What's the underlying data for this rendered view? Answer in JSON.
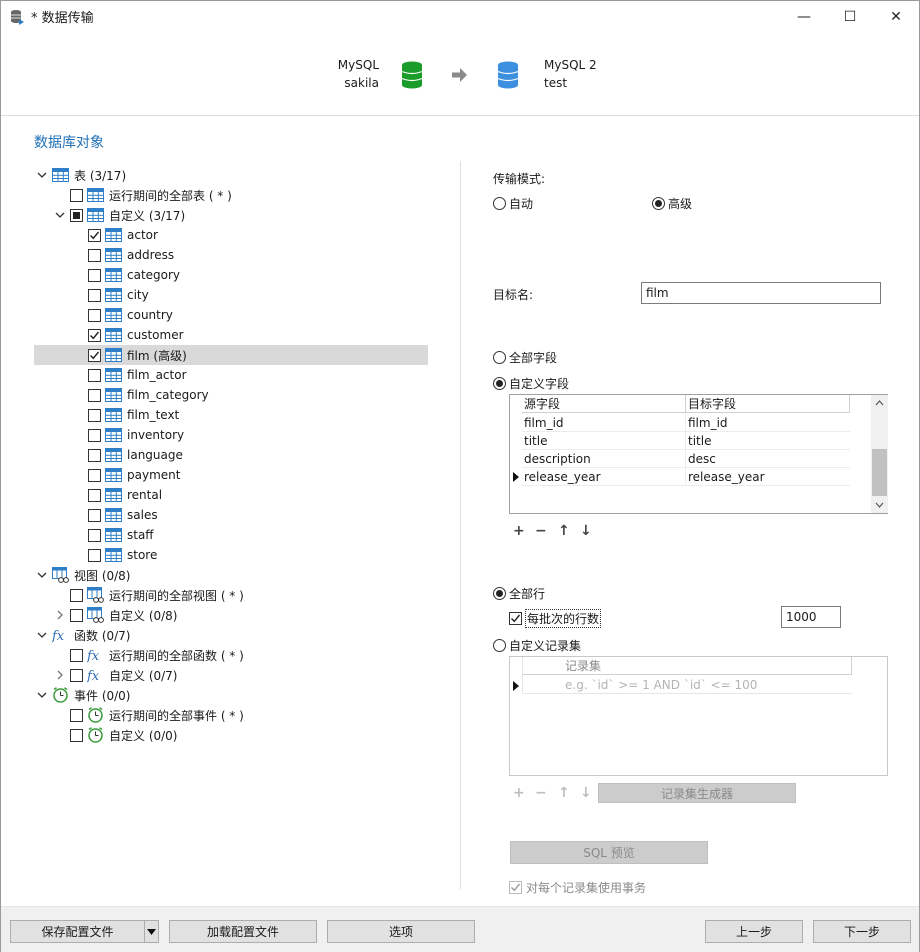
{
  "window": {
    "title": "* 数据传输",
    "controls": {
      "minimize": "—",
      "maximize": "☐",
      "close": "✕"
    }
  },
  "header": {
    "source": {
      "type": "MySQL",
      "name": "sakila"
    },
    "target": {
      "type": "MySQL 2",
      "name": "test"
    },
    "colors": {
      "source_db": "#1a9c2b",
      "target_db": "#3d8fe0",
      "arrow": "#8a8a8a"
    }
  },
  "objects": {
    "title": "数据库对象",
    "tables": {
      "label": "表 (3/17)",
      "all_runtime": "运行期间的全部表 ( * )",
      "custom": "自定义 (3/17)",
      "items": [
        {
          "name": "actor",
          "checked": true
        },
        {
          "name": "address",
          "checked": false
        },
        {
          "name": "category",
          "checked": false
        },
        {
          "name": "city",
          "checked": false
        },
        {
          "name": "country",
          "checked": false
        },
        {
          "name": "customer",
          "checked": true
        },
        {
          "name": "film (高级)",
          "checked": true,
          "selected": true
        },
        {
          "name": "film_actor",
          "checked": false
        },
        {
          "name": "film_category",
          "checked": false
        },
        {
          "name": "film_text",
          "checked": false
        },
        {
          "name": "inventory",
          "checked": false
        },
        {
          "name": "language",
          "checked": false
        },
        {
          "name": "payment",
          "checked": false
        },
        {
          "name": "rental",
          "checked": false
        },
        {
          "name": "sales",
          "checked": false
        },
        {
          "name": "staff",
          "checked": false
        },
        {
          "name": "store",
          "checked": false
        }
      ]
    },
    "views": {
      "label": "视图 (0/8)",
      "all_runtime": "运行期间的全部视图 ( * )",
      "custom": "自定义 (0/8)"
    },
    "functions": {
      "label": "函数 (0/7)",
      "all_runtime": "运行期间的全部函数 ( * )",
      "custom": "自定义 (0/7)"
    },
    "events": {
      "label": "事件 (0/0)",
      "all_runtime": "运行期间的全部事件 ( * )",
      "custom": "自定义 (0/0)"
    }
  },
  "settings": {
    "transfer_mode_label": "传输模式:",
    "mode_auto": "自动",
    "mode_advanced": "高级",
    "target_name_label": "目标名:",
    "target_name_value": "film",
    "all_fields": "全部字段",
    "custom_fields": "自定义字段",
    "fields_header": {
      "source": "源字段",
      "target": "目标字段"
    },
    "fields": [
      {
        "source": "film_id",
        "target": "film_id"
      },
      {
        "source": "title",
        "target": "title"
      },
      {
        "source": "description",
        "target": "desc"
      },
      {
        "source": "release_year",
        "target": "release_year"
      }
    ],
    "all_rows": "全部行",
    "rows_per_batch_label": "每批次的行数",
    "rows_per_batch_value": "1000",
    "custom_recordset": "自定义记录集",
    "recordset_header": "记录集",
    "recordset_placeholder": "e.g. `id` >= 1 AND `id` <= 100",
    "recordset_builder": "记录集生成器",
    "sql_preview": "SQL 预览",
    "use_transaction": "对每个记录集使用事务"
  },
  "footer": {
    "save_profile": "保存配置文件",
    "load_profile": "加载配置文件",
    "options": "选项",
    "prev": "上一步",
    "next": "下一步"
  }
}
